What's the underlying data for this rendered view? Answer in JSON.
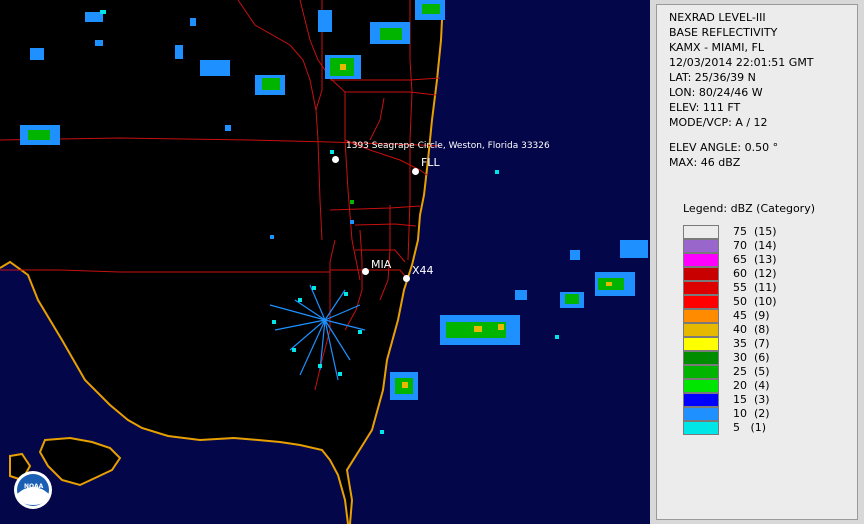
{
  "map": {
    "location_label": "1393 Seagrape Circle, Weston, Florida 33326",
    "sites": [
      {
        "id": "fll",
        "label": "FLL"
      },
      {
        "id": "mia",
        "label": "MIA"
      },
      {
        "id": "x44",
        "label": "X44"
      }
    ],
    "logo_text": "NOAA",
    "colors": {
      "background": "#000000",
      "ocean": "#04064a",
      "coastline": "#e8a000",
      "roads": "#c81010"
    }
  },
  "info": {
    "product": "NEXRAD LEVEL-III",
    "type": "BASE REFLECTIVITY",
    "station": "KAMX - MIAMI, FL",
    "datetime": "12/03/2014 22:01:51 GMT",
    "lat": "LAT: 25/36/39 N",
    "lon": "LON: 80/24/46 W",
    "elev": "ELEV: 111 FT",
    "mode": "MODE/VCP: A / 12",
    "elev_angle": "ELEV ANGLE: 0.50 °",
    "max": "MAX: 46 dBZ"
  },
  "legend": {
    "title": "Legend: dBZ (Category)",
    "items": [
      {
        "label": "75  (15)",
        "color": "#ececec"
      },
      {
        "label": "70  (14)",
        "color": "#9966cc"
      },
      {
        "label": "65  (13)",
        "color": "#ff00ff"
      },
      {
        "label": "60  (12)",
        "color": "#c80000"
      },
      {
        "label": "55  (11)",
        "color": "#dc0000"
      },
      {
        "label": "50  (10)",
        "color": "#ff0000"
      },
      {
        "label": "45  (9)",
        "color": "#ff8c00"
      },
      {
        "label": "40  (8)",
        "color": "#e6b800"
      },
      {
        "label": "35  (7)",
        "color": "#ffff00"
      },
      {
        "label": "30  (6)",
        "color": "#008c00"
      },
      {
        "label": "25  (5)",
        "color": "#00b400"
      },
      {
        "label": "20  (4)",
        "color": "#00e600"
      },
      {
        "label": "15  (3)",
        "color": "#0000ff"
      },
      {
        "label": "10  (2)",
        "color": "#1e90ff"
      },
      {
        "label": "5   (1)",
        "color": "#00e6e6"
      }
    ]
  }
}
